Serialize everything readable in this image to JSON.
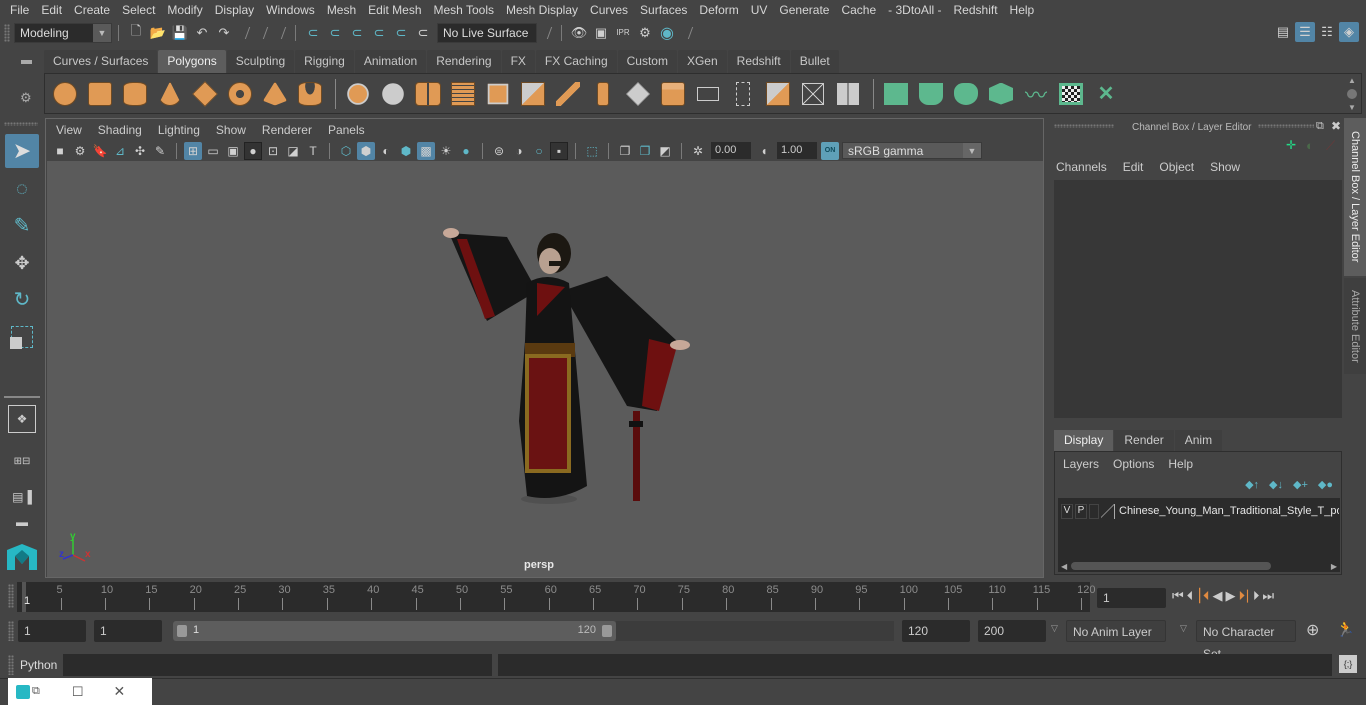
{
  "menubar": {
    "items": [
      "File",
      "Edit",
      "Create",
      "Select",
      "Modify",
      "Display",
      "Windows",
      "Mesh",
      "Edit Mesh",
      "Mesh Tools",
      "Mesh Display",
      "Curves",
      "Surfaces",
      "Deform",
      "UV",
      "Generate",
      "Cache",
      "- 3DtoAll -",
      "Redshift",
      "Help"
    ]
  },
  "statusline": {
    "mode": "Modeling",
    "live_surface": "No Live Surface",
    "icons": [
      "new-scene-icon",
      "open-scene-icon",
      "save-scene-icon",
      "undo-icon",
      "redo-icon",
      "snap-grid-icon",
      "snap-curve-icon",
      "snap-point-icon",
      "snap-view-plane-icon",
      "snap-surface-icon",
      "make-live-icon",
      "render-view-icon",
      "render-frame-icon",
      "ipr-render-icon",
      "render-settings-icon",
      "hypershade-icon"
    ],
    "right_icons": [
      "modeling-toolkit-icon",
      "channel-box-toggle-icon",
      "attribute-editor-toggle-icon",
      "layer-editor-toggle-icon"
    ]
  },
  "shelf": {
    "tabs": [
      "Curves / Surfaces",
      "Polygons",
      "Sculpting",
      "Rigging",
      "Animation",
      "Rendering",
      "FX",
      "FX Caching",
      "Custom",
      "XGen",
      "Redshift",
      "Bullet"
    ],
    "active_tab": "Polygons",
    "tools_orange": [
      "poly-sphere-icon",
      "poly-cube-icon",
      "poly-cylinder-icon",
      "poly-cone-icon",
      "poly-plane-icon",
      "poly-torus-icon",
      "poly-pyramid-icon",
      "poly-pipe-icon"
    ],
    "tools_mixed": [
      "combine-icon",
      "separate-icon",
      "mirror-icon",
      "smooth-icon",
      "extract-icon",
      "bevel-icon",
      "bridge-icon",
      "multi-cut-icon",
      "extrude-icon",
      "append-polygon-icon",
      "merge-icon",
      "center-pivot-icon",
      "fill-hole-icon",
      "target-weld-icon",
      "boolean-icon"
    ],
    "tools_green": [
      "planar-uv-icon",
      "cylindrical-uv-icon",
      "spherical-uv-icon",
      "automatic-uv-icon",
      "unfold-uv-icon",
      "uv-editor-icon",
      "uv-layout-icon"
    ]
  },
  "left_toolbox": {
    "tools": [
      "select-tool-icon",
      "lasso-tool-icon",
      "paint-select-tool-icon",
      "move-tool-icon",
      "rotate-tool-icon",
      "scale-tool-icon"
    ],
    "layouts": [
      "single-view-layout-icon",
      "four-view-layout-icon",
      "outliner-layout-icon",
      "graph-layout-icon"
    ]
  },
  "viewport": {
    "menu": [
      "View",
      "Shading",
      "Lighting",
      "Show",
      "Renderer",
      "Panels"
    ],
    "exposure": "0.00",
    "gamma": "1.00",
    "color_mgmt": "ON",
    "color_space": "sRGB gamma",
    "camera_label": "persp",
    "axis": {
      "x": "x",
      "y": "y",
      "z": "z"
    }
  },
  "channel_box": {
    "title": "Channel Box / Layer Editor",
    "menu": [
      "Channels",
      "Edit",
      "Object",
      "Show"
    ],
    "layer_tabs": [
      "Display",
      "Render",
      "Anim"
    ],
    "active_layer_tab": "Display",
    "layer_menu": [
      "Layers",
      "Options",
      "Help"
    ],
    "layer_row": {
      "v": "V",
      "p": "P",
      "name": "Chinese_Young_Man_Traditional_Style_T_pose"
    },
    "side_tabs": [
      "Channel Box / Layer Editor",
      "Attribute Editor"
    ]
  },
  "timeline": {
    "ticks": [
      "5",
      "10",
      "15",
      "20",
      "25",
      "30",
      "35",
      "40",
      "45",
      "50",
      "55",
      "60",
      "65",
      "70",
      "75",
      "80",
      "85",
      "90",
      "95",
      "100",
      "105",
      "110",
      "115",
      "120"
    ],
    "current": "1",
    "current_frame_field": "1",
    "playback": [
      "go-to-start-icon",
      "step-back-key-icon",
      "step-back-frame-icon",
      "play-back-icon",
      "play-forward-icon",
      "step-forward-frame-icon",
      "step-forward-key-icon",
      "go-to-end-icon"
    ]
  },
  "range": {
    "start": "1",
    "playback_start": "1",
    "slider_min": "1",
    "slider_max": "120",
    "playback_end": "120",
    "end": "200",
    "anim_layer": "No Anim Layer",
    "character_set": "No Character Set"
  },
  "command": {
    "lang": "Python"
  }
}
